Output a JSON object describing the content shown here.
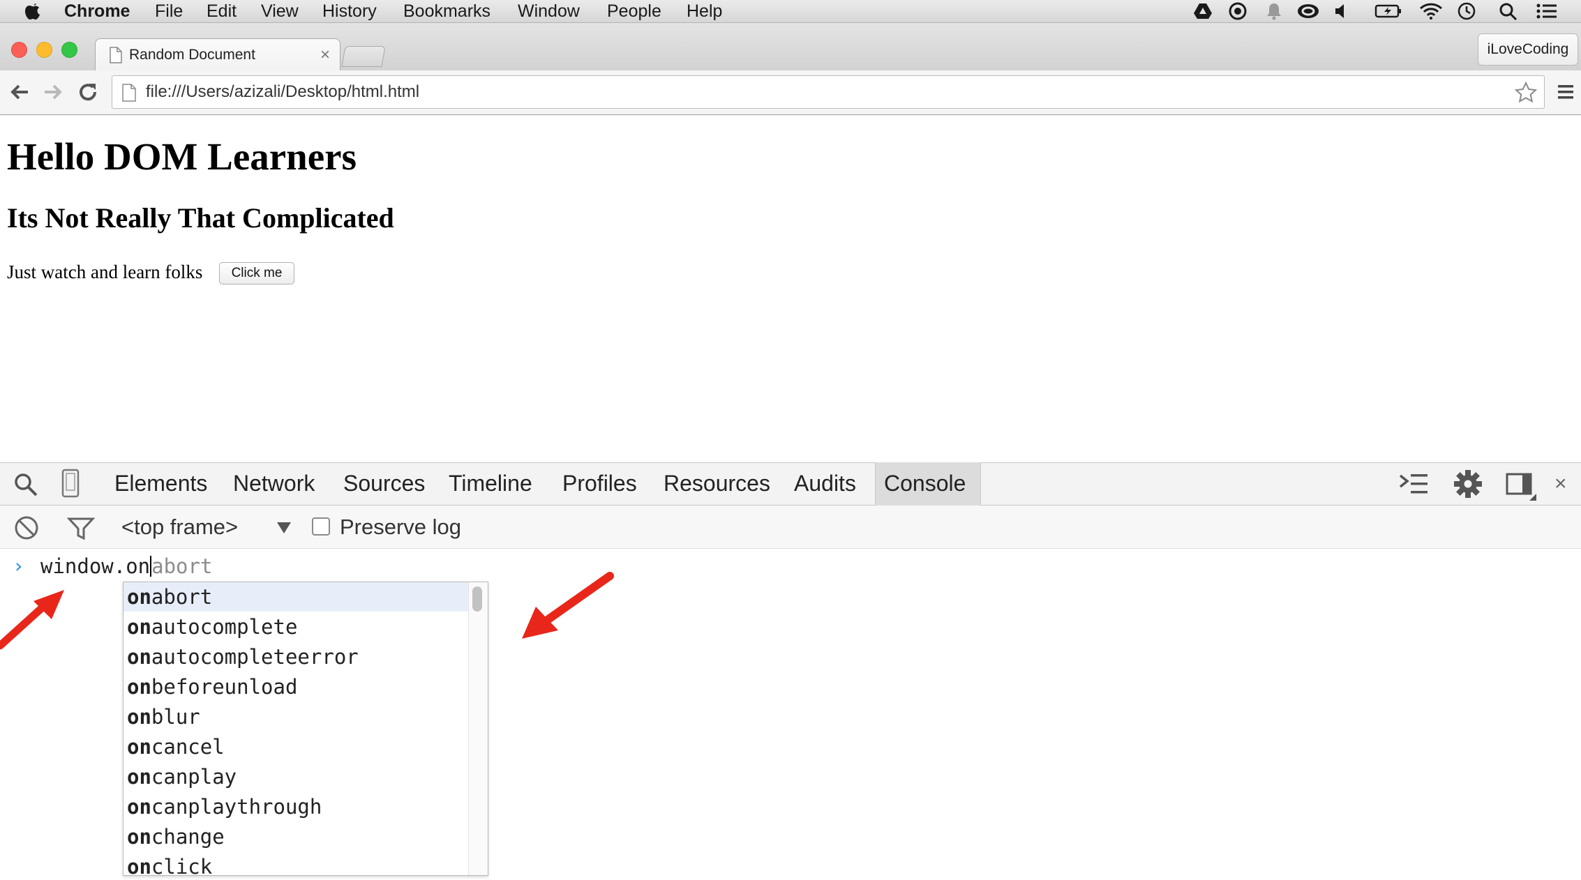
{
  "menubar": {
    "items": [
      "Chrome",
      "File",
      "Edit",
      "View",
      "History",
      "Bookmarks",
      "Window",
      "People",
      "Help"
    ]
  },
  "browser": {
    "tab_title": "Random Document",
    "tab_close": "×",
    "profile_button": "iLoveCoding",
    "url": "file:///Users/azizali/Desktop/html.html"
  },
  "page": {
    "h1": "Hello DOM Learners",
    "h2": "Its Not Really That Complicated",
    "paragraph": "Just watch and learn folks",
    "button": "Click me"
  },
  "devtools": {
    "tabs": [
      "Elements",
      "Network",
      "Sources",
      "Timeline",
      "Profiles",
      "Resources",
      "Audits",
      "Console"
    ],
    "active_tab": "Console",
    "close": "×",
    "context_selector": "<top frame>",
    "preserve_log": "Preserve log",
    "preserve_log_checked": false
  },
  "console": {
    "prompt": "›",
    "typed": "window.on",
    "ghost_completion": "abort",
    "suggestion_prefix": "on",
    "suggestions": [
      "abort",
      "autocomplete",
      "autocompleteerror",
      "beforeunload",
      "blur",
      "cancel",
      "canplay",
      "canplaythrough",
      "change",
      "click"
    ],
    "selected_index": 0
  },
  "colors": {
    "accent_blue": "#2a8ce8",
    "annotation_red": "#e8271a",
    "suggestion_highlight": "#e8eef9"
  }
}
